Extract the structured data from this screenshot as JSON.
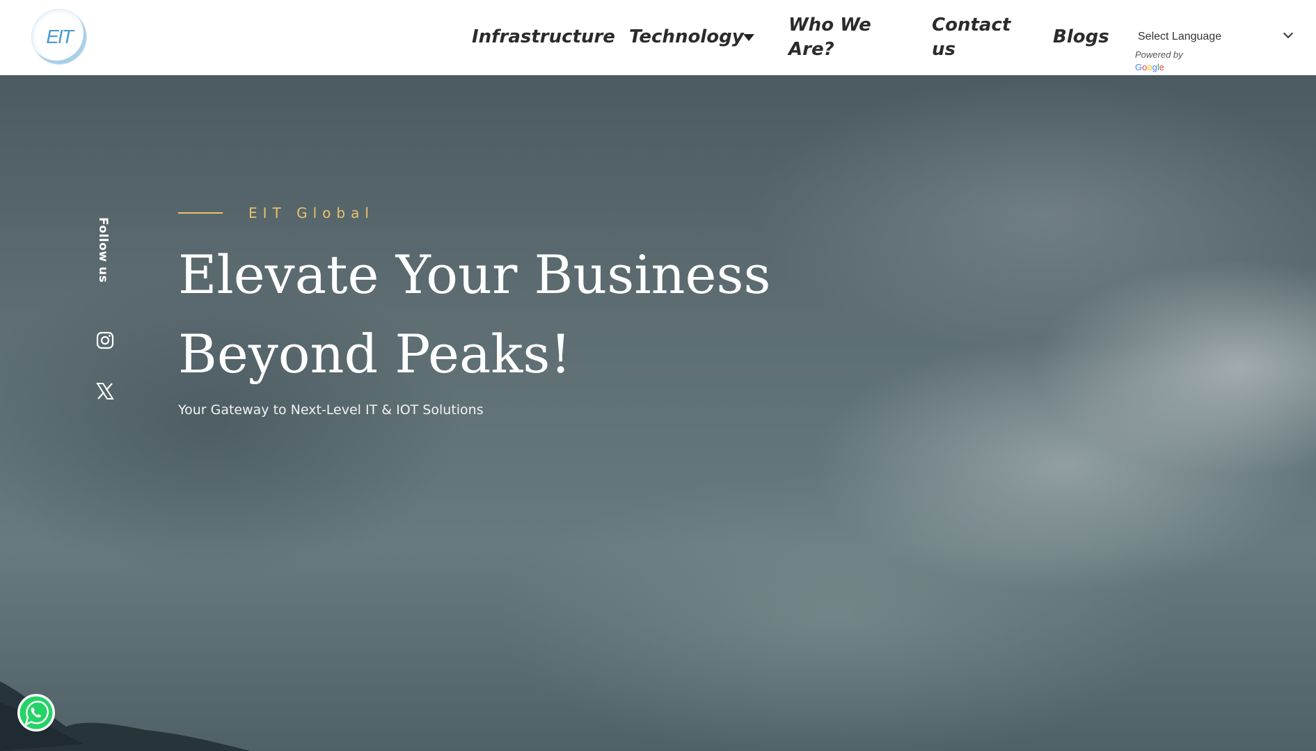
{
  "header": {
    "logo_text": "EIT",
    "nav": {
      "infrastructure": "Infrastructure",
      "technology": "Technology",
      "who_we_are": "Who We Are?",
      "contact": "Contact us",
      "blogs": "Blogs"
    },
    "language": {
      "selected": "Select Language",
      "powered_by": "Powered by",
      "provider": "Google"
    }
  },
  "hero": {
    "follow_label": "Follow us",
    "social_icons": [
      "instagram-icon",
      "x-icon"
    ],
    "eyebrow": "EIT Global",
    "headline": "Elevate Your Business Beyond Peaks!",
    "subtitle": "Your Gateway to Next-Level IT & IOT Solutions"
  },
  "floating": {
    "whatsapp_icon": "whatsapp-icon"
  },
  "colors": {
    "accent_gold": "#e8c26e",
    "logo_blue": "#4a9ad2",
    "whatsapp_green": "#25d366"
  }
}
